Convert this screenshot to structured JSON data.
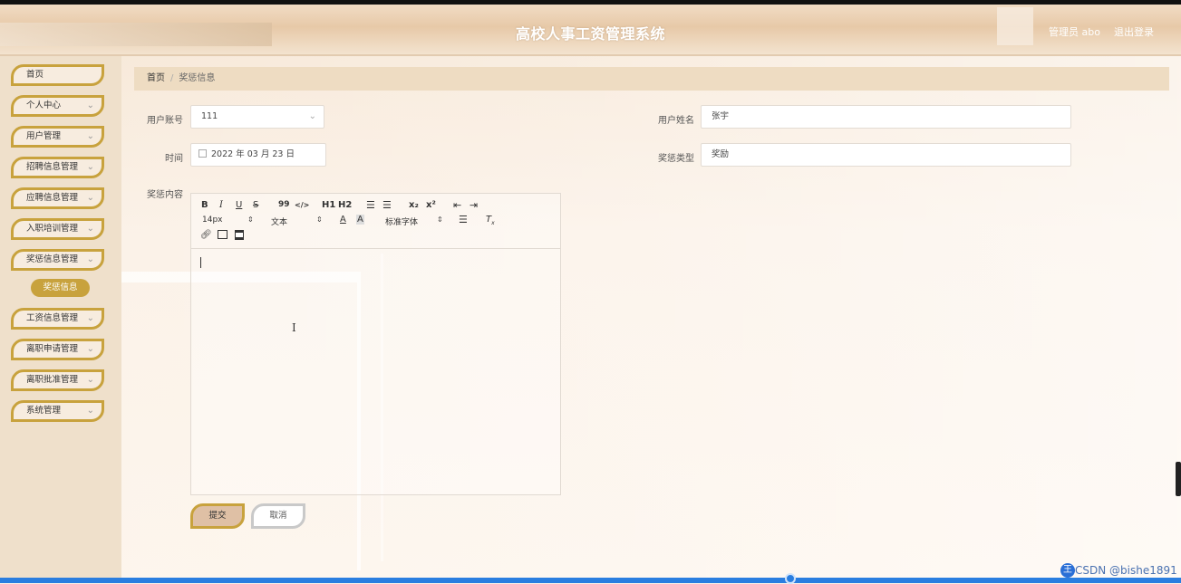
{
  "header": {
    "title": "高校人事工资管理系统",
    "user": "管理员 abo",
    "logout": "退出登录"
  },
  "sidebar": {
    "items": [
      {
        "label": "首页"
      },
      {
        "label": "个人中心"
      },
      {
        "label": "用户管理"
      },
      {
        "label": "招聘信息管理"
      },
      {
        "label": "应聘信息管理"
      },
      {
        "label": "入职培训管理"
      },
      {
        "label": "奖惩信息管理"
      },
      {
        "label": "工资信息管理"
      },
      {
        "label": "离职申请管理"
      },
      {
        "label": "离职批准管理"
      },
      {
        "label": "系统管理"
      }
    ],
    "sub_active": "奖惩信息"
  },
  "breadcrumb": {
    "home": "首页",
    "current": "奖惩信息"
  },
  "form": {
    "account_label": "用户账号",
    "account_value": "111",
    "name_label": "用户姓名",
    "name_value": "张宇",
    "time_label": "时间",
    "time_value": "2022 年 03 月 23 日",
    "type_label": "奖惩类型",
    "type_value": "奖励",
    "content_label": "奖惩内容"
  },
  "editor": {
    "toolbar": {
      "bold": "B",
      "italic": "I",
      "underline": "U",
      "strike": "S",
      "quote": "99",
      "code": "</>",
      "h1": "H1",
      "h2": "H2",
      "sub": "x₂",
      "sup": "x²",
      "size": "14px",
      "text": "文本",
      "color": "A",
      "font": "标准字体"
    }
  },
  "buttons": {
    "submit": "提交",
    "cancel": "取消"
  },
  "watermark": "CSDN @bishe1891",
  "ime": "中"
}
